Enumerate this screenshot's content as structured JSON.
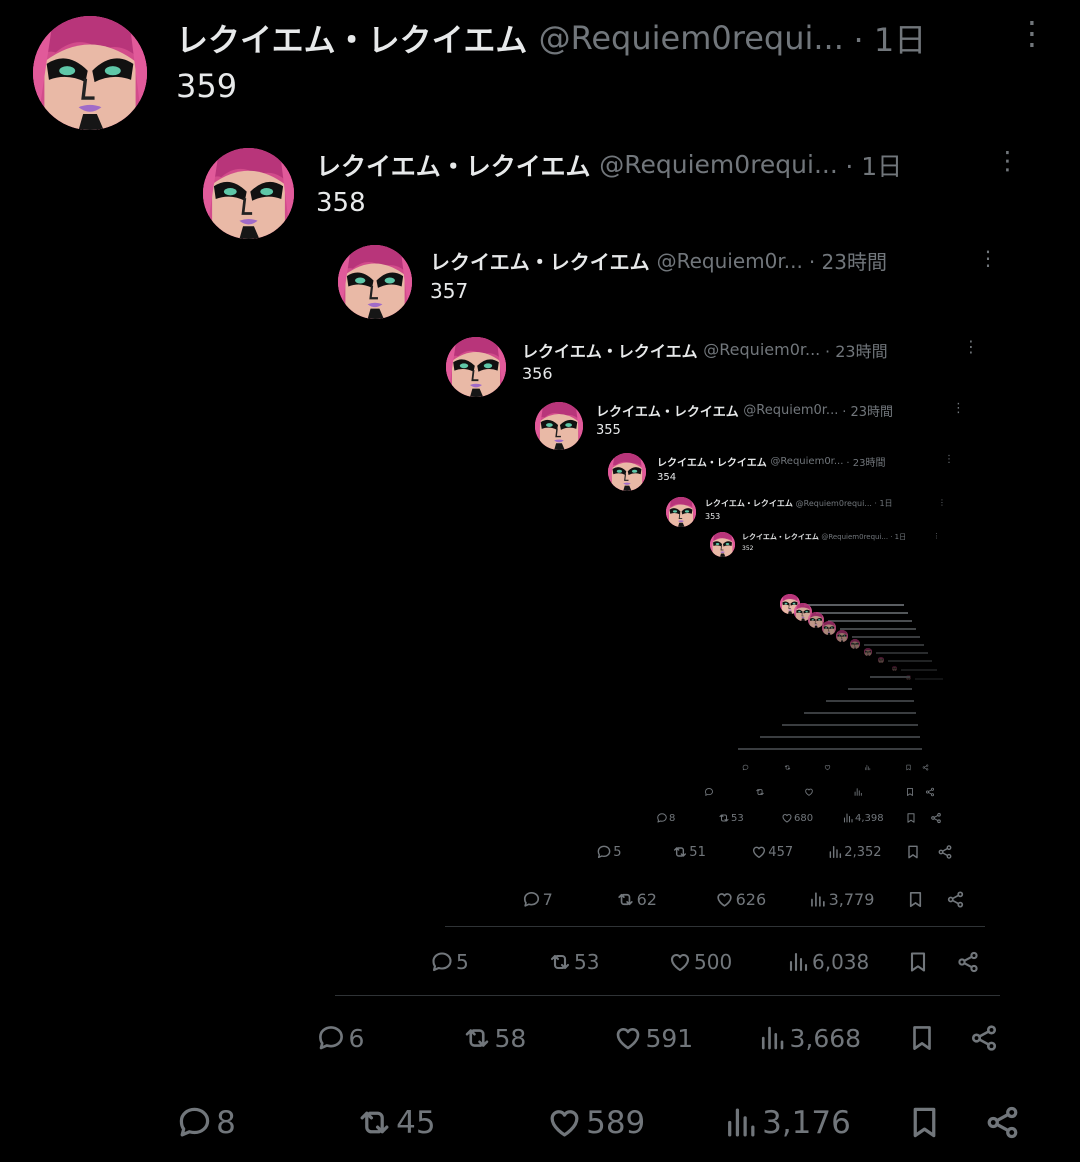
{
  "posts": [
    {
      "name": "レクイエム・レクイエム",
      "handle": "@Requiem0requi...",
      "time": "· 1日",
      "body": "359",
      "actions": {
        "reply": "8",
        "repost": "45",
        "like": "589",
        "views": "3,176"
      }
    },
    {
      "name": "レクイエム・レクイエム",
      "handle": "@Requiem0requi...",
      "time": "· 1日",
      "body": "358",
      "actions": {
        "reply": "6",
        "repost": "58",
        "like": "591",
        "views": "3,668"
      }
    },
    {
      "name": "レクイエム・レクイエム",
      "handle": "@Requiem0r...",
      "time": "· 23時間",
      "body": "357",
      "actions": {
        "reply": "5",
        "repost": "53",
        "like": "500",
        "views": "6,038"
      }
    },
    {
      "name": "レクイエム・レクイエム",
      "handle": "@Requiem0r...",
      "time": "· 23時間",
      "body": "356",
      "actions": {
        "reply": "7",
        "repost": "62",
        "like": "626",
        "views": "3,779"
      }
    },
    {
      "name": "レクイエム・レクイエム",
      "handle": "@Requiem0r...",
      "time": "· 23時間",
      "body": "355",
      "actions": {
        "reply": "5",
        "repost": "51",
        "like": "457",
        "views": "2,352"
      }
    },
    {
      "name": "レクイエム・レクイエム",
      "handle": "@Requiem0r...",
      "time": "· 23時間",
      "body": "354",
      "actions": {
        "reply": "8",
        "repost": "53",
        "like": "680",
        "views": "4,398"
      }
    },
    {
      "name": "レクイエム・レクイエム",
      "handle": "@Requiem0requi...",
      "time": "· 1日",
      "body": "353",
      "actions": {
        "reply": "",
        "repost": "",
        "like": "",
        "views": ""
      }
    },
    {
      "name": "レクイエム・レクイエム",
      "handle": "@Requiem0requi...",
      "time": "· 1日",
      "body": "352",
      "actions": {
        "reply": "",
        "repost": "",
        "like": "",
        "views": ""
      }
    }
  ],
  "icons": {
    "avatar": "character-avatar",
    "more": "more-vertical-icon",
    "reply": "reply-icon",
    "repost": "repost-icon",
    "like": "heart-icon",
    "views": "views-chart-icon",
    "bookmark": "bookmark-icon",
    "share": "share-icon"
  },
  "colors": {
    "background": "#000000",
    "text": "#e7e9ea",
    "muted": "#71767b",
    "avatar_pink": "#c23f7a"
  }
}
